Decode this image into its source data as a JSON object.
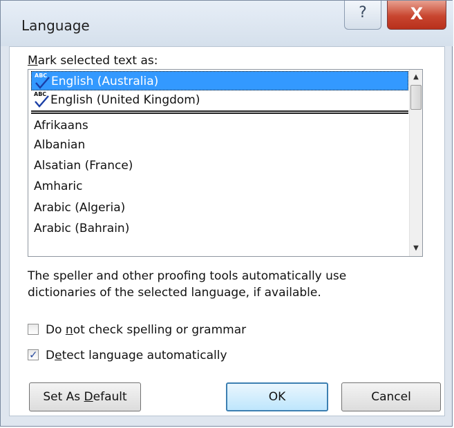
{
  "window": {
    "title": "Language",
    "help_glyph": "?",
    "close_glyph": "X"
  },
  "mark_label": {
    "mnemonic": "M",
    "rest": "ark selected text as:"
  },
  "list": {
    "items": [
      {
        "label": "English (Australia)",
        "proofing_icon": true,
        "selected": true
      },
      {
        "label": "English (United Kingdom)",
        "proofing_icon": true,
        "selected": false
      },
      {
        "label": "Afrikaans",
        "proofing_icon": false,
        "selected": false
      },
      {
        "label": "Albanian",
        "proofing_icon": false,
        "selected": false
      },
      {
        "label": "Alsatian (France)",
        "proofing_icon": false,
        "selected": false
      },
      {
        "label": "Amharic",
        "proofing_icon": false,
        "selected": false
      },
      {
        "label": "Arabic (Algeria)",
        "proofing_icon": false,
        "selected": false
      },
      {
        "label": "Arabic (Bahrain)",
        "proofing_icon": false,
        "selected": false
      }
    ],
    "icon_text": "ABC",
    "scroll_up_glyph": "▲",
    "scroll_down_glyph": "▼"
  },
  "info": {
    "line1": "The speller and other proofing tools automatically use",
    "line2": "dictionaries of the selected language, if available."
  },
  "options": {
    "no_check": {
      "pre": "Do ",
      "mnemonic": "n",
      "post": "ot check spelling or grammar",
      "checked": false
    },
    "detect": {
      "pre": "D",
      "mnemonic": "e",
      "post": "tect language automatically",
      "checked": true
    }
  },
  "buttons": {
    "set_default": {
      "pre": "Set As ",
      "mnemonic": "D",
      "post": "efault"
    },
    "ok": "OK",
    "cancel": "Cancel"
  },
  "colors": {
    "selection": "#3399ff",
    "close_red": "#c8452f",
    "check_blue": "#2b4c9e"
  }
}
